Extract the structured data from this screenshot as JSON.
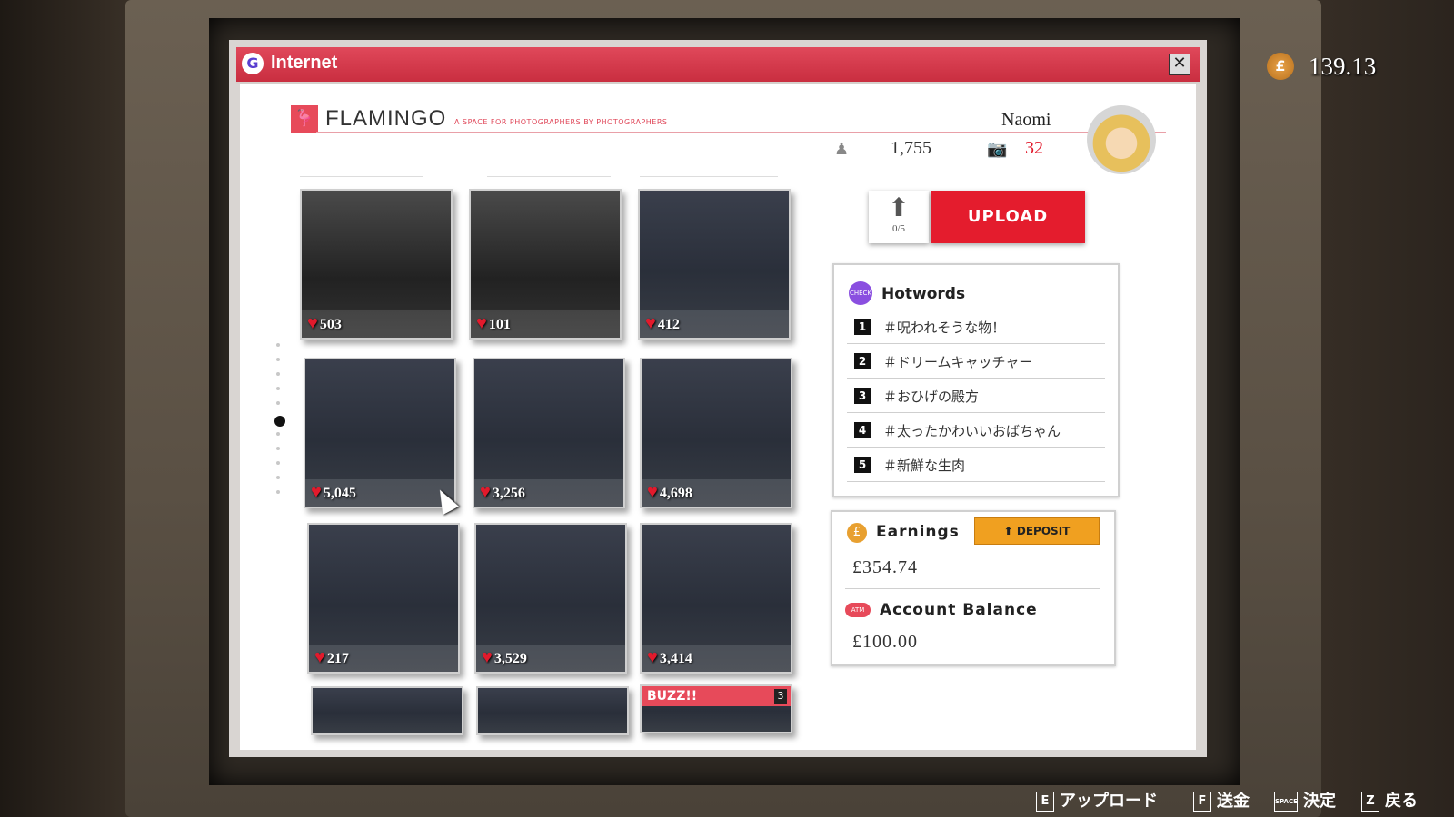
{
  "window": {
    "title": "Internet",
    "close_glyph": "✕"
  },
  "site": {
    "name": "FLAMINGO",
    "tagline": "A SPACE FOR PHOTOGRAPHERS BY PHOTOGRAPHERS",
    "logo_icon": "flamingo-icon"
  },
  "profile": {
    "username": "Naomi",
    "followers": "1,755",
    "photos": "32",
    "photos_color": "#e21a2c"
  },
  "gallery": {
    "photos": [
      {
        "likes": "503"
      },
      {
        "likes": "101"
      },
      {
        "likes": "412"
      },
      {
        "likes": "5,045"
      },
      {
        "likes": "3,256"
      },
      {
        "likes": "4,698"
      },
      {
        "likes": "217"
      },
      {
        "likes": "3,529"
      },
      {
        "likes": "3,414"
      }
    ],
    "buzz_label": "BUZZ!!",
    "buzz_count": "3"
  },
  "upload": {
    "label": "UPLOAD",
    "count": "0/5",
    "color": "#e41c2d"
  },
  "hotwords": {
    "title": "Hotwords",
    "badge": "CHECK",
    "items": [
      {
        "rank": "1",
        "text": "＃呪われそうな物！"
      },
      {
        "rank": "2",
        "text": "＃ドリームキャッチャー"
      },
      {
        "rank": "3",
        "text": "＃おひげの殿方"
      },
      {
        "rank": "4",
        "text": "＃太ったかわいいおばちゃん"
      },
      {
        "rank": "5",
        "text": "＃新鮮な生肉"
      }
    ]
  },
  "earnings": {
    "title": "Earnings",
    "amount": "£354.74",
    "deposit_label": "DEPOSIT",
    "account_title": "Account Balance",
    "account_amount": "£100.00",
    "atm_label": "ATM"
  },
  "wallet": {
    "symbol": "£",
    "amount": "139.13"
  },
  "hints": [
    {
      "key": "E",
      "label": "アップロード"
    },
    {
      "key": "F",
      "label": "送金"
    },
    {
      "key": "SPACE",
      "label": "決定"
    },
    {
      "key": "Z",
      "label": "戻る"
    }
  ]
}
